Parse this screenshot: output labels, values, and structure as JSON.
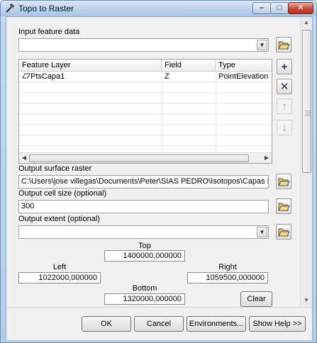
{
  "window": {
    "title": "Topo to Raster",
    "minimize_glyph": "–",
    "maximize_glyph": "□",
    "close_glyph": "✕"
  },
  "input_features": {
    "label": "Input feature data",
    "value": "",
    "browse_icon": "open-folder-icon",
    "columns": [
      "Feature Layer",
      "Field",
      "Type"
    ],
    "rows": [
      {
        "layer": "PtsCapa1",
        "field": "Z",
        "type": "PointElevation"
      }
    ],
    "side_buttons": [
      {
        "name": "add",
        "glyph": "+",
        "enabled": true
      },
      {
        "name": "remove",
        "glyph": "✕",
        "enabled": true
      },
      {
        "name": "move-up",
        "glyph": "↑",
        "enabled": false
      },
      {
        "name": "move-down",
        "glyph": "↓",
        "enabled": false
      }
    ]
  },
  "output_raster": {
    "label": "Output surface raster",
    "value": "C:\\Users\\jose villegas\\Documents\\Peter\\SIAS PEDRO\\Isotopos\\Capas Modflow"
  },
  "cell_size": {
    "label": "Output cell size (optional)",
    "value": "300"
  },
  "extent": {
    "label": "Output extent (optional)",
    "value": "",
    "top_label": "Top",
    "top": "1400000,000000",
    "left_label": "Left",
    "left": "1022000,000000",
    "right_label": "Right",
    "right": "1059500,000000",
    "bottom_label": "Bottom",
    "bottom": "1320000,000000",
    "clear_label": "Clear"
  },
  "footer": {
    "ok": "OK",
    "cancel": "Cancel",
    "environments": "Environments...",
    "show_help": "Show Help >>"
  }
}
